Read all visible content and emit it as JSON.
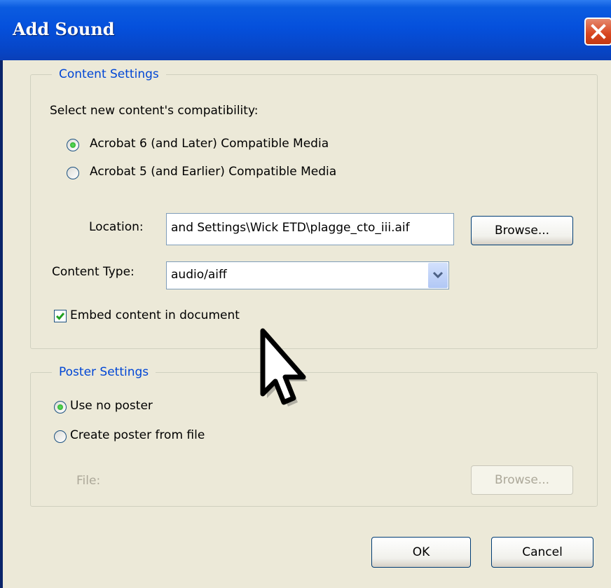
{
  "dialog": {
    "title": "Add Sound"
  },
  "content_settings": {
    "legend": "Content Settings",
    "compat_label": "Select new content's compatibility:",
    "option_acrobat6": "Acrobat 6 (and Later) Compatible Media",
    "option_acrobat5": "Acrobat 5 (and Earlier) Compatible Media",
    "location_label": "Location:",
    "location_value": "and Settings\\Wick ETD\\plagge_cto_iii.aif",
    "browse_label": "Browse...",
    "content_type_label": "Content Type:",
    "content_type_value": "audio/aiff",
    "embed_label": "Embed content in document"
  },
  "poster_settings": {
    "legend": "Poster Settings",
    "option_no_poster": "Use no poster",
    "option_from_file": "Create poster from file",
    "file_label": "File:",
    "browse_label": "Browse..."
  },
  "footer": {
    "ok_label": "OK",
    "cancel_label": "Cancel"
  }
}
